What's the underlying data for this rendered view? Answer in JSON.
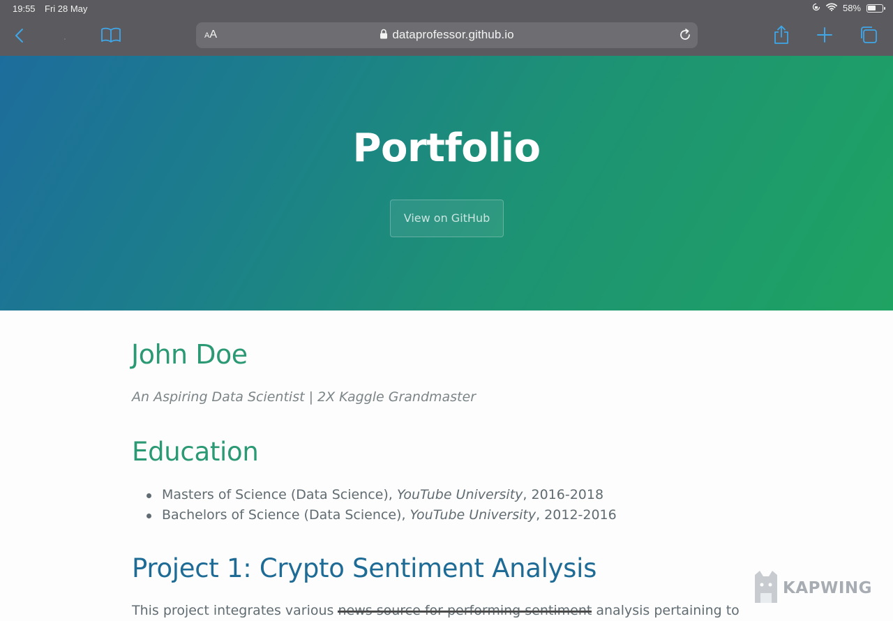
{
  "status_bar": {
    "time": "19:55",
    "date": "Fri 28 May",
    "battery_text": "58%",
    "battery_level": 0.58
  },
  "browser": {
    "text_size_label_small": "A",
    "text_size_label_large": "A",
    "url": "dataprofessor.github.io",
    "accent_color": "#3fa6e8",
    "icons": [
      "back-icon",
      "forward-icon",
      "bookmarks-icon",
      "lock-icon",
      "reload-icon",
      "share-icon",
      "new-tab-icon",
      "tabs-icon"
    ]
  },
  "hero": {
    "title": "Portfolio",
    "button_label": "View on GitHub",
    "gradient_start": "#1d6d9c",
    "gradient_end": "#1fa362"
  },
  "profile": {
    "name": "John Doe",
    "tagline": "An Aspiring Data Scientist | 2X Kaggle Grandmaster"
  },
  "education": {
    "heading": "Education",
    "items": [
      {
        "degree": "Masters of Science (Data Science), ",
        "school": "YouTube University",
        "years": ", 2016-2018"
      },
      {
        "degree": "Bachelors of Science (Data Science), ",
        "school": "YouTube University",
        "years": ", 2012-2016"
      }
    ]
  },
  "project1": {
    "heading": "Project 1: Crypto Sentiment Analysis",
    "text_start": "This project integrates various ",
    "text_struck": "news source for performing sentiment",
    "text_end": " analysis pertaining to"
  },
  "watermark": {
    "label": "KAPWING"
  }
}
